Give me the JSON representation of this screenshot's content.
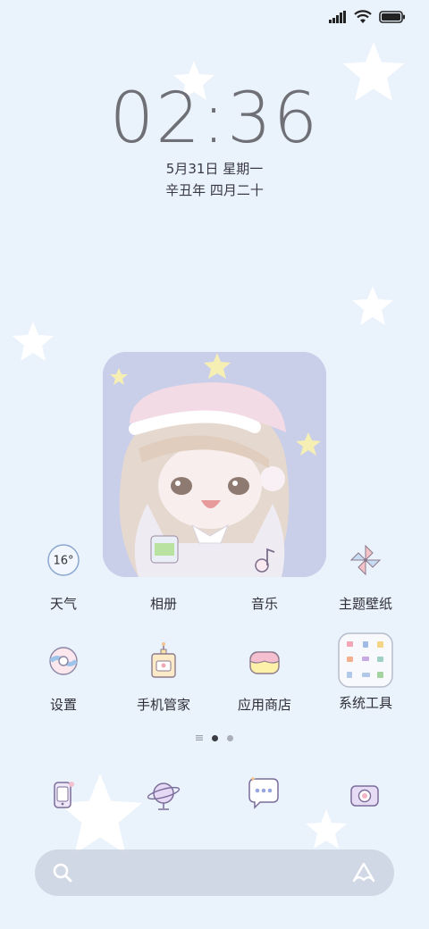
{
  "status_bar": {
    "signal_icon": "signal-icon",
    "wifi_icon": "wifi-icon",
    "battery_icon": "battery-icon"
  },
  "lock": {
    "time": "02:36",
    "date": "5月31日 星期一",
    "lunar_date": "辛丑年 四月二十"
  },
  "widget": {
    "image": "anime-girl-photo"
  },
  "apps_row1": [
    {
      "label": "天气",
      "icon": "weather-icon",
      "temp": "16°"
    },
    {
      "label": "相册",
      "icon": "gallery-icon"
    },
    {
      "label": "音乐",
      "icon": "music-icon"
    },
    {
      "label": "主题壁纸",
      "icon": "pinwheel-icon"
    }
  ],
  "apps_row2": [
    {
      "label": "设置",
      "icon": "settings-icon"
    },
    {
      "label": "手机管家",
      "icon": "security-icon"
    },
    {
      "label": "应用商店",
      "icon": "app-store-icon"
    },
    {
      "label": "系统工具",
      "icon": "folder-icon"
    }
  ],
  "page_indicator": {
    "pages": 3,
    "current": 2
  },
  "dock": [
    {
      "icon": "phone-icon"
    },
    {
      "icon": "browser-globe-icon"
    },
    {
      "icon": "messages-icon"
    },
    {
      "icon": "camera-icon"
    }
  ],
  "search": {
    "search_icon": "search-icon",
    "assistant_icon": "assistant-icon"
  },
  "colors": {
    "background": "#eaf2fc",
    "text": "#2e2e36",
    "clock": "#6f6f76"
  }
}
